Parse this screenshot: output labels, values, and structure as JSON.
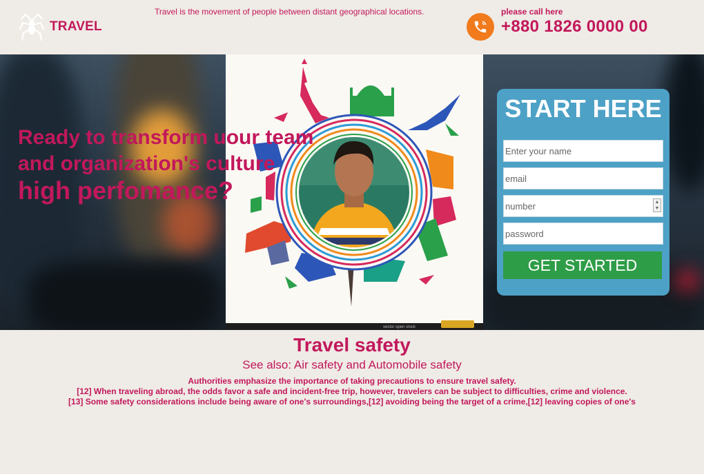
{
  "header": {
    "logo_text": "TRAVEL",
    "tagline": "Travel is the movement of people between distant geographical locations.",
    "call_label": "please call here",
    "phone": "+880 1826 0000 00"
  },
  "hero": {
    "headline_line1": "Ready to transform uour team",
    "headline_line2": "and organization's culture",
    "headline_line3": "high perfomance?",
    "image_credit": "vector open stock"
  },
  "form": {
    "title": "START HERE",
    "name_placeholder": "Enter your name",
    "email_placeholder": "email",
    "number_placeholder": "number",
    "password_placeholder": "password",
    "submit_label": "GET STARTED"
  },
  "article": {
    "title": "Travel safety",
    "subtitle": "See also: Air safety and Automobile safety",
    "line1": "Authorities emphasize the importance of taking precautions to ensure travel safety.",
    "line2": "[12] When traveling abroad, the odds favor a safe and incident-free trip, however, travelers can be subject to difficulties, crime and violence.",
    "line3": "[13] Some safety considerations include being aware of one's surroundings,[12] avoiding being the target of a crime,[12] leaving copies of one's"
  },
  "colors": {
    "brand": "#c2185b",
    "form_bg": "#4da1c6",
    "cta": "#2e9d47",
    "phone_icon": "#f07a1c",
    "page_bg": "#efebe6"
  }
}
